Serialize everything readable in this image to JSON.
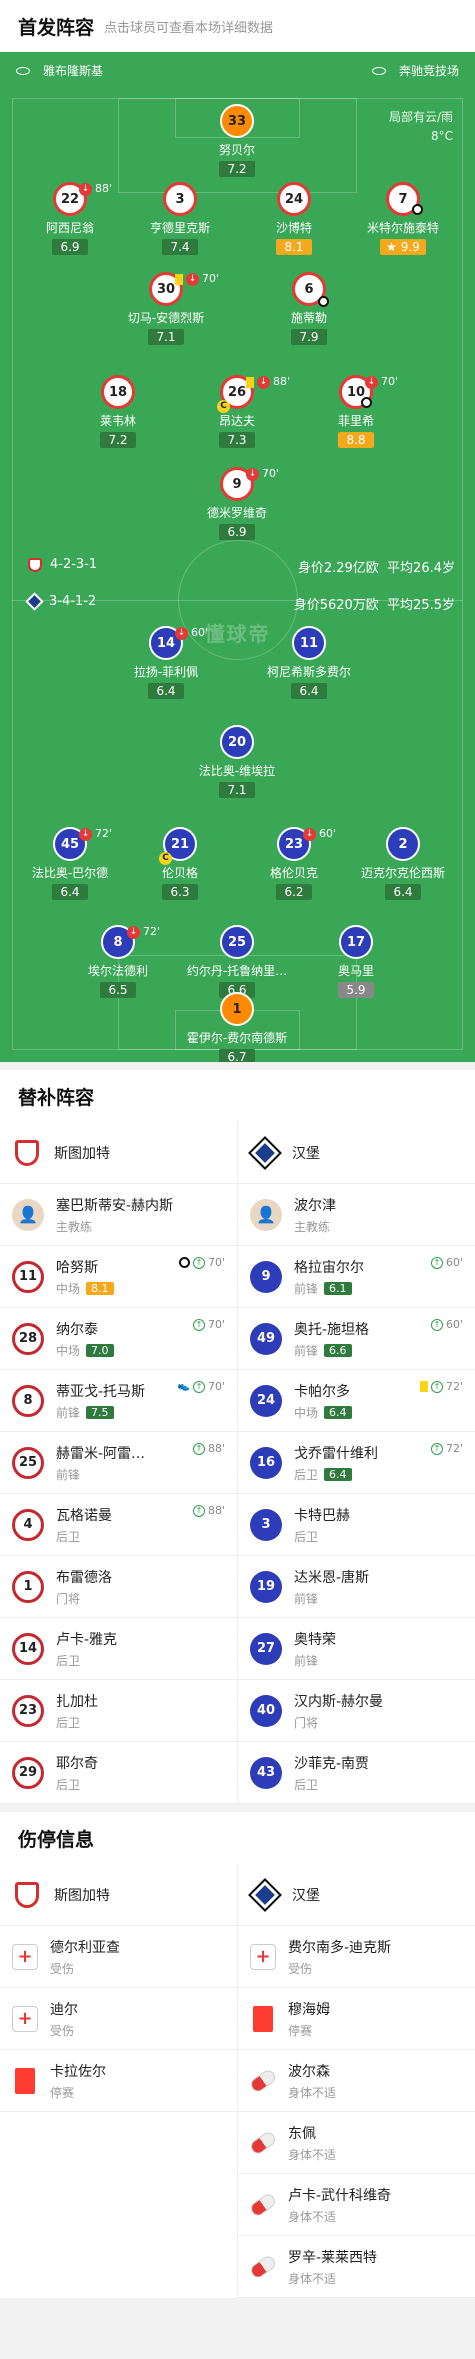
{
  "lineup": {
    "title": "首发阵容",
    "hint": "点击球员可查看本场详细数据"
  },
  "home": {
    "name": "斯图加特",
    "venue": "雅布隆斯基",
    "formation": "4-2-3-1",
    "value": "身价2.29亿欧",
    "avg_age": "平均26.4岁"
  },
  "away": {
    "name": "汉堡",
    "venue": "奔驰竞技场",
    "formation": "3-4-1-2",
    "value": "身价5620万欧",
    "avg_age": "平均25.5岁"
  },
  "weather": {
    "desc": "局部有云/雨",
    "temp": "8°C"
  },
  "watermark": "懂球帝",
  "home_players": [
    {
      "num": "33",
      "name": "努贝尔",
      "rating": "7.2"
    },
    {
      "num": "22",
      "name": "阿西尼翁",
      "rating": "6.9",
      "sub": "88'"
    },
    {
      "num": "3",
      "name": "亨德里克斯",
      "rating": "7.4"
    },
    {
      "num": "24",
      "name": "沙博特",
      "rating": "8.1"
    },
    {
      "num": "7",
      "name": "米特尔施泰特",
      "rating": "9.9"
    },
    {
      "num": "30",
      "name": "切马-安德烈斯",
      "rating": "7.1",
      "sub": "70'"
    },
    {
      "num": "6",
      "name": "施蒂勒",
      "rating": "7.9"
    },
    {
      "num": "18",
      "name": "莱韦林",
      "rating": "7.2"
    },
    {
      "num": "26",
      "name": "昂达夫",
      "rating": "7.3",
      "sub": "88'"
    },
    {
      "num": "10",
      "name": "菲里希",
      "rating": "8.8",
      "sub": "70'"
    },
    {
      "num": "9",
      "name": "德米罗维奇",
      "rating": "6.9",
      "sub": "70'"
    }
  ],
  "away_players": [
    {
      "num": "14",
      "name": "拉扬-菲利佩",
      "rating": "6.4",
      "sub": "60'"
    },
    {
      "num": "11",
      "name": "柯尼希斯多费尔",
      "rating": "6.4"
    },
    {
      "num": "20",
      "name": "法比奥-维埃拉",
      "rating": "7.1"
    },
    {
      "num": "45",
      "name": "法比奥-巴尔德",
      "rating": "6.4",
      "sub": "72'"
    },
    {
      "num": "21",
      "name": "伦贝格",
      "rating": "6.3"
    },
    {
      "num": "23",
      "name": "格伦贝克",
      "rating": "6.2",
      "sub": "60'"
    },
    {
      "num": "2",
      "name": "迈克尔克伦西斯",
      "rating": "6.4"
    },
    {
      "num": "8",
      "name": "埃尔法德利",
      "rating": "6.5",
      "sub": "72'"
    },
    {
      "num": "25",
      "name": "约尔丹-托鲁纳里…",
      "rating": "6.6"
    },
    {
      "num": "17",
      "name": "奥马里",
      "rating": "5.9"
    },
    {
      "num": "1",
      "name": "霍伊尔-费尔南德斯",
      "rating": "6.7"
    }
  ],
  "subs": {
    "title": "替补阵容",
    "home_coach": {
      "name": "塞巴斯蒂安-赫内斯",
      "role": "主教练"
    },
    "away_coach": {
      "name": "波尔津",
      "role": "主教练"
    },
    "home": [
      {
        "num": "11",
        "name": "哈努斯",
        "pos": "中场",
        "rating": "8.1",
        "min": "70'"
      },
      {
        "num": "28",
        "name": "纳尔泰",
        "pos": "中场",
        "rating": "7.0",
        "min": "70'"
      },
      {
        "num": "8",
        "name": "蒂亚戈-托马斯",
        "pos": "前锋",
        "rating": "7.5",
        "min": "70'"
      },
      {
        "num": "25",
        "name": "赫雷米-阿雷…",
        "pos": "前锋",
        "rating": "",
        "min": "88'"
      },
      {
        "num": "4",
        "name": "瓦格诺曼",
        "pos": "后卫",
        "rating": "",
        "min": "88'"
      },
      {
        "num": "1",
        "name": "布雷德洛",
        "pos": "门将",
        "rating": "",
        "min": ""
      },
      {
        "num": "14",
        "name": "卢卡-雅克",
        "pos": "后卫",
        "rating": "",
        "min": ""
      },
      {
        "num": "23",
        "name": "扎加杜",
        "pos": "后卫",
        "rating": "",
        "min": ""
      },
      {
        "num": "29",
        "name": "耶尔奇",
        "pos": "后卫",
        "rating": "",
        "min": ""
      }
    ],
    "away": [
      {
        "num": "9",
        "name": "格拉宙尔尔",
        "pos": "前锋",
        "rating": "6.1",
        "min": "60'"
      },
      {
        "num": "49",
        "name": "奥托-施坦格",
        "pos": "前锋",
        "rating": "6.6",
        "min": "60'"
      },
      {
        "num": "24",
        "name": "卡帕尔多",
        "pos": "中场",
        "rating": "6.4",
        "min": "72'"
      },
      {
        "num": "16",
        "name": "戈乔雷什维利",
        "pos": "后卫",
        "rating": "6.4",
        "min": "72'"
      },
      {
        "num": "3",
        "name": "卡特巴赫",
        "pos": "后卫",
        "rating": "",
        "min": ""
      },
      {
        "num": "19",
        "name": "达米恩-唐斯",
        "pos": "前锋",
        "rating": "",
        "min": ""
      },
      {
        "num": "27",
        "name": "奥特荣",
        "pos": "前锋",
        "rating": "",
        "min": ""
      },
      {
        "num": "40",
        "name": "汉内斯-赫尔曼",
        "pos": "门将",
        "rating": "",
        "min": ""
      },
      {
        "num": "43",
        "name": "沙菲克-南贾",
        "pos": "后卫",
        "rating": "",
        "min": ""
      }
    ]
  },
  "injuries": {
    "title": "伤停信息",
    "home": [
      {
        "name": "德尔利亚查",
        "status": "受伤"
      },
      {
        "name": "迪尔",
        "status": "受伤"
      },
      {
        "name": "卡拉佐尔",
        "status": "停赛"
      }
    ],
    "away": [
      {
        "name": "费尔南多-迪克斯",
        "status": "受伤"
      },
      {
        "name": "穆海姆",
        "status": "停赛"
      },
      {
        "name": "波尔森",
        "status": "身体不适"
      },
      {
        "name": "东佩",
        "status": "身体不适"
      },
      {
        "name": "卢卡-武什科维奇",
        "status": "身体不适"
      },
      {
        "name": "罗辛-莱莱西特",
        "status": "身体不适"
      }
    ]
  }
}
